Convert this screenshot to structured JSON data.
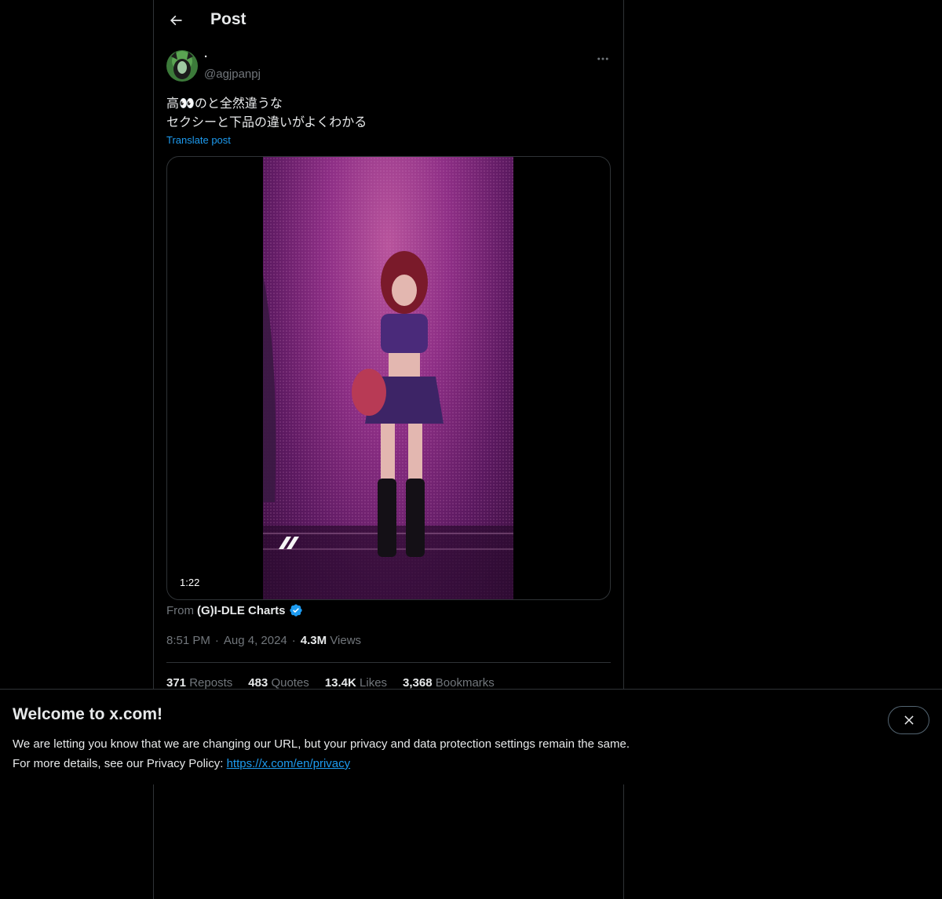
{
  "header": {
    "title": "Post"
  },
  "post": {
    "display_name": "·",
    "handle": "@agjpanpj",
    "text_line1": "高👀のと全然違うな",
    "text_line2": "セクシーと下品の違いがよくわかる",
    "translate_label": "Translate post",
    "video_duration": "1:22",
    "source_prefix": "From",
    "source_name": "(G)I-DLE Charts",
    "time": "8:51 PM",
    "date": "Aug 4, 2024",
    "views_count": "4.3M",
    "views_label": "Views",
    "sep": "·"
  },
  "stats": [
    {
      "count": "371",
      "label": "Reposts"
    },
    {
      "count": "483",
      "label": "Quotes"
    },
    {
      "count": "13.4K",
      "label": "Likes"
    },
    {
      "count": "3,368",
      "label": "Bookmarks"
    }
  ],
  "banner": {
    "title": "Welcome to x.com!",
    "line1": "We are letting you know that we are changing our URL, but your privacy and data protection settings remain the same.",
    "line2_prefix": "For more details, see our Privacy Policy: ",
    "link": "https://x.com/en/privacy"
  },
  "icons": {
    "back": "arrow-left-icon",
    "more": "more-horizontal-icon",
    "verified": "verified-badge-icon",
    "close": "close-icon"
  },
  "colors": {
    "accent": "#1d9bf0",
    "background": "#000000",
    "text": "#e7e9ea",
    "muted": "#71767b",
    "border": "#2f3336"
  }
}
